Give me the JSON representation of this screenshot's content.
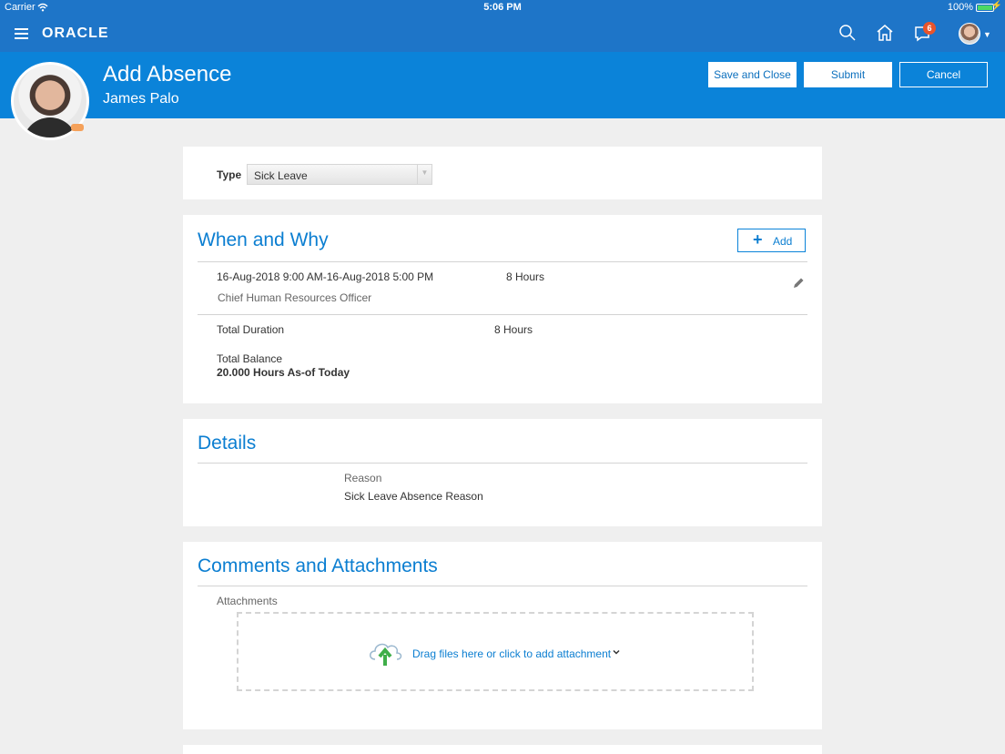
{
  "status_bar": {
    "carrier": "Carrier",
    "time": "5:06 PM",
    "battery": "100%"
  },
  "nav": {
    "logo": "ORACLE",
    "notification_count": "6",
    "icons": [
      "menu-icon",
      "search-icon",
      "home-icon",
      "notifications-icon",
      "user-avatar",
      "chevron-down-icon"
    ]
  },
  "header": {
    "title": "Add Absence",
    "subtitle": "James Palo",
    "buttons": {
      "save_close": "Save and Close",
      "submit": "Submit",
      "cancel": "Cancel"
    }
  },
  "type_section": {
    "label": "Type",
    "selected": "Sick Leave"
  },
  "when_why": {
    "title": "When and Why",
    "add_label": "Add",
    "entry": {
      "dates": "16-Aug-2018 9:00 AM-16-Aug-2018 5:00 PM",
      "duration": "8 Hours",
      "role": "Chief Human Resources Officer"
    },
    "total_duration_label": "Total Duration",
    "total_duration_value": "8 Hours",
    "total_balance_label": "Total Balance",
    "total_balance_value": "20.000 Hours As-of Today"
  },
  "details": {
    "title": "Details",
    "reason_label": "Reason",
    "reason_value": "Sick Leave Absence Reason"
  },
  "comments": {
    "title": "Comments and Attachments",
    "attachments_label": "Attachments",
    "drop_text": "Drag files here or click to add attachment"
  },
  "colors": {
    "nav_blue": "#1e75c8",
    "header_blue": "#0b83d9",
    "accent": "#0b7ed1",
    "badge": "#e8542b"
  }
}
